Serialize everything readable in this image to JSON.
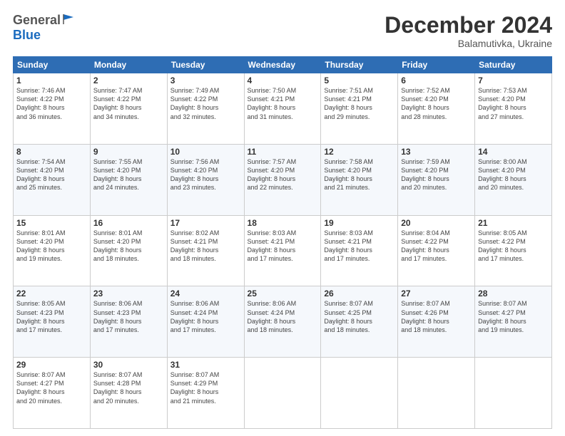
{
  "header": {
    "logo_general": "General",
    "logo_blue": "Blue",
    "month_title": "December 2024",
    "subtitle": "Balamutivka, Ukraine"
  },
  "weekdays": [
    "Sunday",
    "Monday",
    "Tuesday",
    "Wednesday",
    "Thursday",
    "Friday",
    "Saturday"
  ],
  "weeks": [
    [
      {
        "day": "1",
        "info": "Sunrise: 7:46 AM\nSunset: 4:22 PM\nDaylight: 8 hours\nand 36 minutes."
      },
      {
        "day": "2",
        "info": "Sunrise: 7:47 AM\nSunset: 4:22 PM\nDaylight: 8 hours\nand 34 minutes."
      },
      {
        "day": "3",
        "info": "Sunrise: 7:49 AM\nSunset: 4:22 PM\nDaylight: 8 hours\nand 32 minutes."
      },
      {
        "day": "4",
        "info": "Sunrise: 7:50 AM\nSunset: 4:21 PM\nDaylight: 8 hours\nand 31 minutes."
      },
      {
        "day": "5",
        "info": "Sunrise: 7:51 AM\nSunset: 4:21 PM\nDaylight: 8 hours\nand 29 minutes."
      },
      {
        "day": "6",
        "info": "Sunrise: 7:52 AM\nSunset: 4:20 PM\nDaylight: 8 hours\nand 28 minutes."
      },
      {
        "day": "7",
        "info": "Sunrise: 7:53 AM\nSunset: 4:20 PM\nDaylight: 8 hours\nand 27 minutes."
      }
    ],
    [
      {
        "day": "8",
        "info": "Sunrise: 7:54 AM\nSunset: 4:20 PM\nDaylight: 8 hours\nand 25 minutes."
      },
      {
        "day": "9",
        "info": "Sunrise: 7:55 AM\nSunset: 4:20 PM\nDaylight: 8 hours\nand 24 minutes."
      },
      {
        "day": "10",
        "info": "Sunrise: 7:56 AM\nSunset: 4:20 PM\nDaylight: 8 hours\nand 23 minutes."
      },
      {
        "day": "11",
        "info": "Sunrise: 7:57 AM\nSunset: 4:20 PM\nDaylight: 8 hours\nand 22 minutes."
      },
      {
        "day": "12",
        "info": "Sunrise: 7:58 AM\nSunset: 4:20 PM\nDaylight: 8 hours\nand 21 minutes."
      },
      {
        "day": "13",
        "info": "Sunrise: 7:59 AM\nSunset: 4:20 PM\nDaylight: 8 hours\nand 20 minutes."
      },
      {
        "day": "14",
        "info": "Sunrise: 8:00 AM\nSunset: 4:20 PM\nDaylight: 8 hours\nand 20 minutes."
      }
    ],
    [
      {
        "day": "15",
        "info": "Sunrise: 8:01 AM\nSunset: 4:20 PM\nDaylight: 8 hours\nand 19 minutes."
      },
      {
        "day": "16",
        "info": "Sunrise: 8:01 AM\nSunset: 4:20 PM\nDaylight: 8 hours\nand 18 minutes."
      },
      {
        "day": "17",
        "info": "Sunrise: 8:02 AM\nSunset: 4:21 PM\nDaylight: 8 hours\nand 18 minutes."
      },
      {
        "day": "18",
        "info": "Sunrise: 8:03 AM\nSunset: 4:21 PM\nDaylight: 8 hours\nand 17 minutes."
      },
      {
        "day": "19",
        "info": "Sunrise: 8:03 AM\nSunset: 4:21 PM\nDaylight: 8 hours\nand 17 minutes."
      },
      {
        "day": "20",
        "info": "Sunrise: 8:04 AM\nSunset: 4:22 PM\nDaylight: 8 hours\nand 17 minutes."
      },
      {
        "day": "21",
        "info": "Sunrise: 8:05 AM\nSunset: 4:22 PM\nDaylight: 8 hours\nand 17 minutes."
      }
    ],
    [
      {
        "day": "22",
        "info": "Sunrise: 8:05 AM\nSunset: 4:23 PM\nDaylight: 8 hours\nand 17 minutes."
      },
      {
        "day": "23",
        "info": "Sunrise: 8:06 AM\nSunset: 4:23 PM\nDaylight: 8 hours\nand 17 minutes."
      },
      {
        "day": "24",
        "info": "Sunrise: 8:06 AM\nSunset: 4:24 PM\nDaylight: 8 hours\nand 17 minutes."
      },
      {
        "day": "25",
        "info": "Sunrise: 8:06 AM\nSunset: 4:24 PM\nDaylight: 8 hours\nand 18 minutes."
      },
      {
        "day": "26",
        "info": "Sunrise: 8:07 AM\nSunset: 4:25 PM\nDaylight: 8 hours\nand 18 minutes."
      },
      {
        "day": "27",
        "info": "Sunrise: 8:07 AM\nSunset: 4:26 PM\nDaylight: 8 hours\nand 18 minutes."
      },
      {
        "day": "28",
        "info": "Sunrise: 8:07 AM\nSunset: 4:27 PM\nDaylight: 8 hours\nand 19 minutes."
      }
    ],
    [
      {
        "day": "29",
        "info": "Sunrise: 8:07 AM\nSunset: 4:27 PM\nDaylight: 8 hours\nand 20 minutes."
      },
      {
        "day": "30",
        "info": "Sunrise: 8:07 AM\nSunset: 4:28 PM\nDaylight: 8 hours\nand 20 minutes."
      },
      {
        "day": "31",
        "info": "Sunrise: 8:07 AM\nSunset: 4:29 PM\nDaylight: 8 hours\nand 21 minutes."
      },
      {
        "day": "",
        "info": ""
      },
      {
        "day": "",
        "info": ""
      },
      {
        "day": "",
        "info": ""
      },
      {
        "day": "",
        "info": ""
      }
    ]
  ]
}
